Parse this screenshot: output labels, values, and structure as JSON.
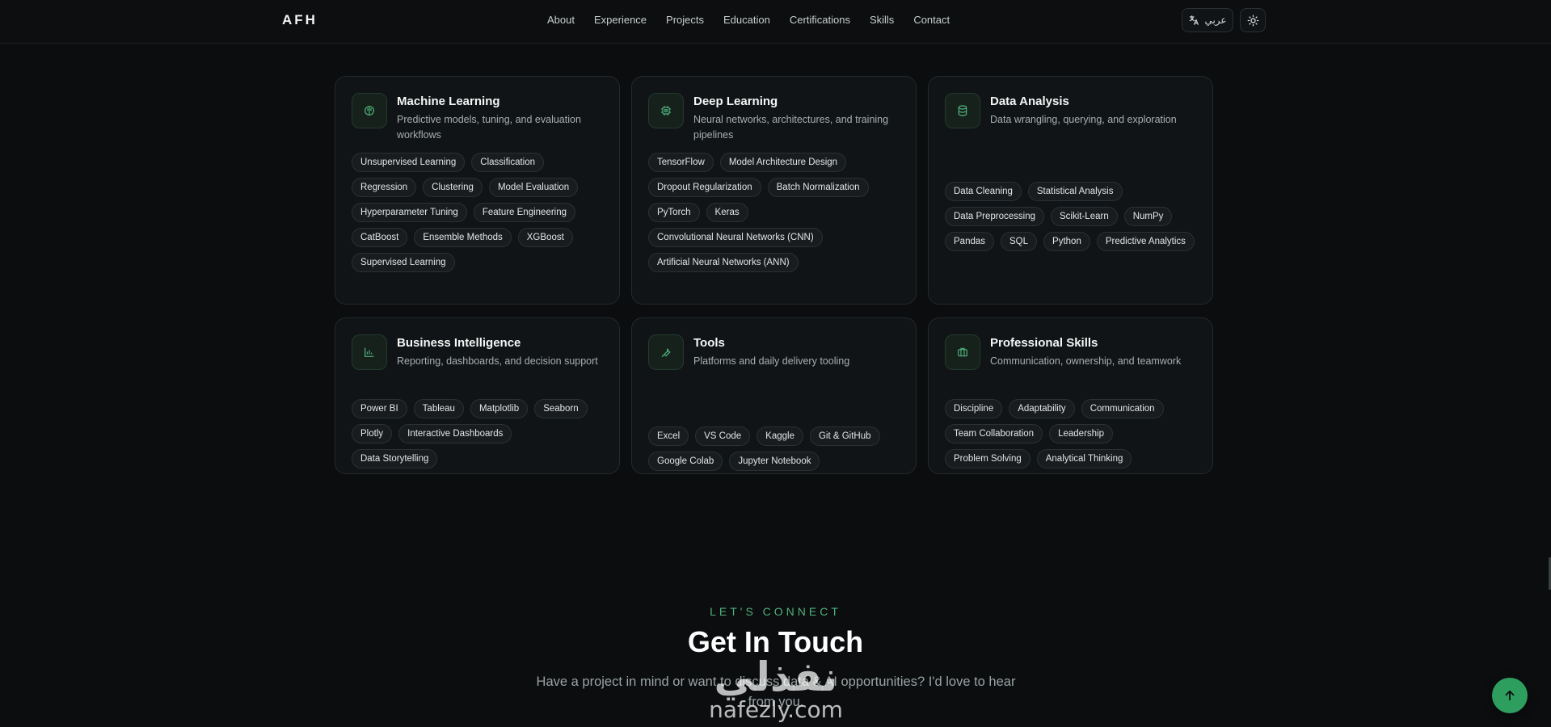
{
  "header": {
    "logo": "AFH",
    "nav": [
      "About",
      "Experience",
      "Projects",
      "Education",
      "Certifications",
      "Skills",
      "Contact"
    ],
    "lang_label": "عربي"
  },
  "skills": [
    {
      "title": "Machine Learning",
      "desc": "Predictive models, tuning, and evaluation workflows",
      "icon": "brain-icon",
      "tags": [
        "Unsupervised Learning",
        "Classification",
        "Regression",
        "Clustering",
        "Model Evaluation",
        "Hyperparameter Tuning",
        "Feature Engineering",
        "CatBoost",
        "Ensemble Methods",
        "XGBoost",
        "Supervised Learning"
      ]
    },
    {
      "title": "Deep Learning",
      "desc": "Neural networks, architectures, and training pipelines",
      "icon": "cpu-icon",
      "tags": [
        "TensorFlow",
        "Model Architecture Design",
        "Dropout Regularization",
        "Batch Normalization",
        "PyTorch",
        "Keras",
        "Convolutional Neural Networks (CNN)",
        "Artificial Neural Networks (ANN)"
      ]
    },
    {
      "title": "Data Analysis",
      "desc": "Data wrangling, querying, and exploration",
      "icon": "database-icon",
      "tags": [
        "Data Cleaning",
        "Statistical Analysis",
        "Data Preprocessing",
        "Scikit-Learn",
        "NumPy",
        "Pandas",
        "SQL",
        "Python",
        "Predictive Analytics"
      ]
    },
    {
      "title": "Business Intelligence",
      "desc": "Reporting, dashboards, and decision support",
      "icon": "bar-chart-icon",
      "tags": [
        "Power BI",
        "Tableau",
        "Matplotlib",
        "Seaborn",
        "Plotly",
        "Interactive Dashboards",
        "Data Storytelling"
      ]
    },
    {
      "title": "Tools",
      "desc": "Platforms and daily delivery tooling",
      "icon": "wrench-icon",
      "tags": [
        "Excel",
        "VS Code",
        "Kaggle",
        "Git & GitHub",
        "Google Colab",
        "Jupyter Notebook"
      ]
    },
    {
      "title": "Professional Skills",
      "desc": "Communication, ownership, and teamwork",
      "icon": "briefcase-icon",
      "tags": [
        "Discipline",
        "Adaptability",
        "Communication",
        "Team Collaboration",
        "Leadership",
        "Problem Solving",
        "Analytical Thinking"
      ]
    }
  ],
  "contact": {
    "eyebrow": "LET'S CONNECT",
    "title": "Get In Touch",
    "subtitle": "Have a project in mind or want to discuss data & AI opportunities? I'd love to hear from you."
  },
  "watermark": {
    "arabic": "نفذلي",
    "latin": "nafezly.com"
  },
  "colors": {
    "accent": "#4fb07a",
    "background": "#0b0d0f",
    "card": "#111416"
  }
}
